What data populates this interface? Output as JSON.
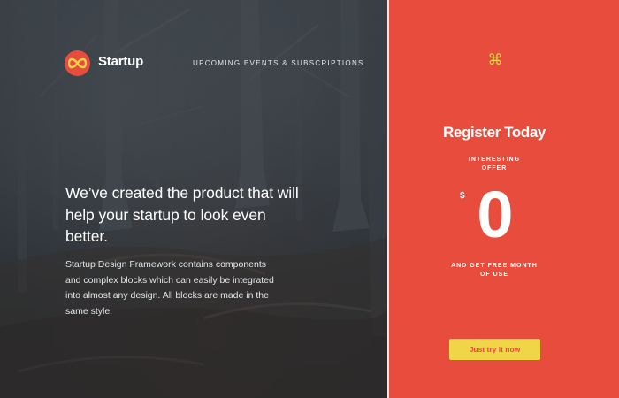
{
  "colors": {
    "accent": "#e74c3c",
    "button_yellow": "#f1d548",
    "text_white": "#ffffff"
  },
  "header": {
    "logo_icon": "infinity-icon",
    "brand": "Startup",
    "nav_link": "UPCOMING EVENTS & SUBSCRIPTIONS"
  },
  "hero": {
    "headline": "We’ve created the product that will help your startup to look even better.",
    "description": "Startup Design Framework contains components and complex blocks which can easily be integrated into almost any design. All blocks are made in the same style."
  },
  "register": {
    "icon": "command-icon",
    "icon_glyph": "⌘",
    "title": "Register Today",
    "offer_label": "INTERESTING OFFER",
    "currency": "$",
    "price": "0",
    "free_label": "AND GET FREE MONTH OF USE",
    "cta_label": "Just try it now"
  }
}
